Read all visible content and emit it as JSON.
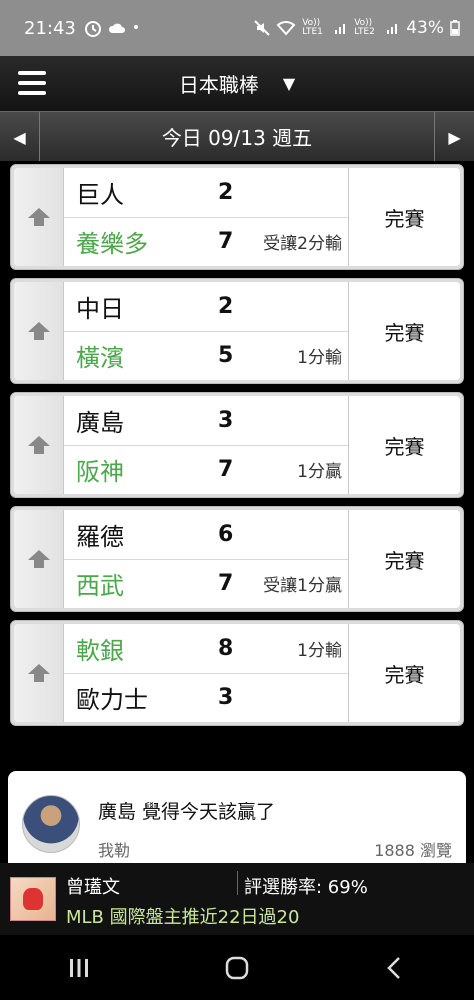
{
  "status_bar": {
    "time": "21:43",
    "battery": "43%",
    "lte1": "Vo)) LTE1",
    "lte2": "Vo)) LTE2"
  },
  "header": {
    "title": "日本職棒",
    "dropdown_icon": "▼"
  },
  "date_bar": {
    "label": "今日 09/13 週五",
    "prev_icon": "◀",
    "next_icon": "▶"
  },
  "games": [
    {
      "team1": {
        "name": "巨人",
        "score": "2",
        "note": "",
        "highlight": false
      },
      "team2": {
        "name": "養樂多",
        "score": "7",
        "note": "受讓2分輸",
        "highlight": true
      },
      "status": "完賽"
    },
    {
      "team1": {
        "name": "中日",
        "score": "2",
        "note": "",
        "highlight": false
      },
      "team2": {
        "name": "橫濱",
        "score": "5",
        "note": "1分輸",
        "highlight": true
      },
      "status": "完賽"
    },
    {
      "team1": {
        "name": "廣島",
        "score": "3",
        "note": "",
        "highlight": false
      },
      "team2": {
        "name": "阪神",
        "score": "7",
        "note": "1分贏",
        "highlight": true
      },
      "status": "完賽"
    },
    {
      "team1": {
        "name": "羅德",
        "score": "6",
        "note": "",
        "highlight": false
      },
      "team2": {
        "name": "西武",
        "score": "7",
        "note": "受讓1分贏",
        "highlight": true
      },
      "status": "完賽"
    },
    {
      "team1": {
        "name": "軟銀",
        "score": "8",
        "note": "1分輸",
        "highlight": true
      },
      "team2": {
        "name": "歐力士",
        "score": "3",
        "note": "",
        "highlight": false
      },
      "status": "完賽"
    }
  ],
  "article": {
    "title": "廣島 覺得今天該贏了",
    "author": "我勒",
    "views": "1888 瀏覽"
  },
  "ad": {
    "name": "曾瓂文",
    "rate": "評選勝率: 69%",
    "tagline": "MLB 國際盤主推近22日過20"
  },
  "colors": {
    "highlight_team": "#4aa84a",
    "ad_tagline": "#c9e89a"
  }
}
